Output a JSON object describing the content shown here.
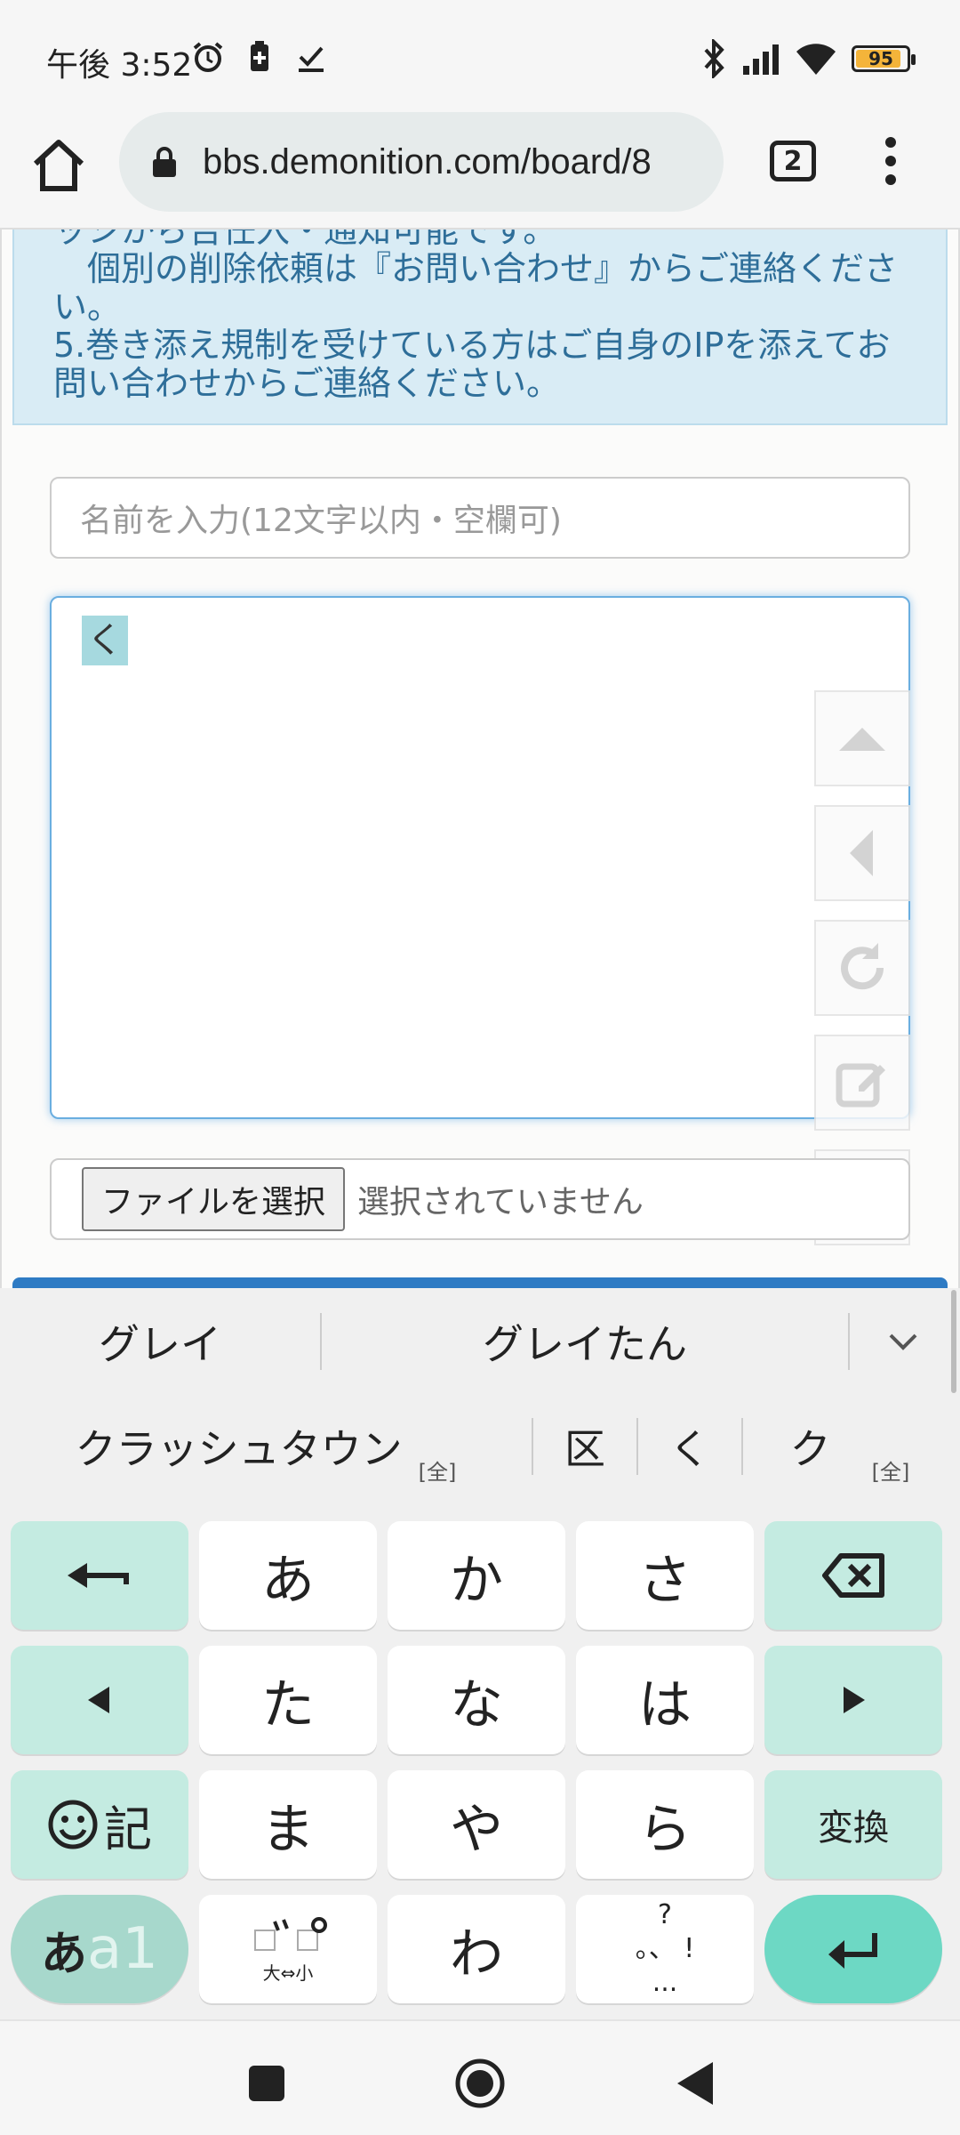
{
  "status_bar": {
    "time": "午後 3:52",
    "battery_level": "95",
    "left_icons": [
      "alarm-icon",
      "battery-saver-icon",
      "check-icon"
    ],
    "right_icons": [
      "bluetooth-icon",
      "signal-icon",
      "wifi-icon",
      "battery-icon"
    ]
  },
  "browser": {
    "url": "bbs.demonition.com/board/8",
    "tab_count": "2"
  },
  "notice": {
    "lines": [
      "ッシから告任入・通知可能です。",
      "　個別の削除依頼は『お問い合わせ』からご連絡くださ",
      "い。",
      "5.巻き添え規制を受けている方はご自身のIPを添えてお",
      "問い合わせからご連絡ください。"
    ]
  },
  "form": {
    "name_placeholder": "名前を入力(12文字以内・空欄可)",
    "body_text": "く",
    "file_button": "ファイルを選択",
    "file_status": "選択されていません"
  },
  "keyboard": {
    "candidates_row1": [
      "グレイ",
      "グレイたん"
    ],
    "candidates_row2": [
      "クラッシュタウン",
      "区",
      "く",
      "ク"
    ],
    "zen_badge": "[全]",
    "keys": {
      "a": "あ",
      "ka": "か",
      "sa": "さ",
      "ta": "た",
      "na": "な",
      "ha": "は",
      "symbols": "記",
      "ma": "ま",
      "ya": "や",
      "ra": "ら",
      "convert": "変換",
      "mode_kana": "あ",
      "mode_alpha": "a1",
      "dakuten_label": "大⇔小",
      "wa": "わ",
      "punct_top": "?",
      "punct_mid": "。、 !",
      "punct_bottom": "..."
    },
    "accent_color": "#c4ebe1",
    "enter_color": "#6dd8c4"
  }
}
